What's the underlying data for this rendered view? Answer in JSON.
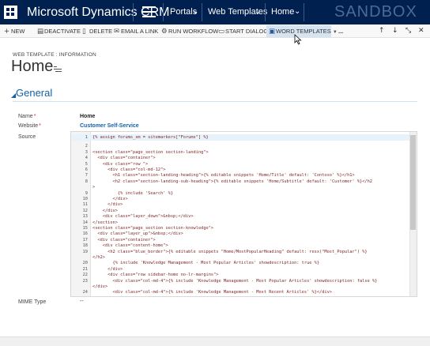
{
  "nav": {
    "app_title": "Microsoft Dynamics CRM",
    "items": [
      {
        "label": "Portals"
      },
      {
        "label": "Web Templates"
      },
      {
        "label": "Home"
      }
    ],
    "environment_watermark": "SANDBOX",
    "colors": {
      "bar": "#002050",
      "watermark": "#4d6a96"
    }
  },
  "commands": [
    {
      "label": "NEW",
      "icon": "plus-icon"
    },
    {
      "label": "DEACTIVATE",
      "icon": "deactivate-icon"
    },
    {
      "label": "DELETE",
      "icon": "trash-icon"
    },
    {
      "label": "EMAIL A LINK",
      "icon": "email-icon"
    },
    {
      "label": "RUN WORKFLOW",
      "icon": "workflow-icon"
    },
    {
      "label": "START DIALOG",
      "icon": "dialog-icon"
    },
    {
      "label": "WORD TEMPLATES",
      "icon": "word-icon",
      "has_dropdown": true,
      "active": true
    },
    {
      "label": "...",
      "icon": "more-icon"
    }
  ],
  "record": {
    "entity_label": "WEB TEMPLATE : INFORMATION",
    "title": "Home"
  },
  "section": {
    "title": "General",
    "accent": "#1560a8"
  },
  "fields": {
    "name_label": "Name",
    "name_value": "Home",
    "website_label": "Website",
    "website_value": "Customer Self-Service",
    "source_label": "Source",
    "mime_label": "MIME Type",
    "mime_value": "--"
  },
  "code_lines": [
    {
      "num": "1",
      "text": "{% assign forums_sm = sitemarkers[\"Forums\"] %}"
    },
    {
      "num": "2",
      "text": ""
    },
    {
      "num": "3",
      "text": "<section class=\"page_section section-landing\">"
    },
    {
      "num": "4",
      "text": "  <div class=\"container\">"
    },
    {
      "num": "5",
      "text": "    <div class=\"row \">"
    },
    {
      "num": "6",
      "text": "      <div class=\"col-md-12\">"
    },
    {
      "num": "7",
      "text": "        <h1 class=\"section-landing-heading\">{% editable snippets 'Home/Title' default: 'Contoso' %}</h1>"
    },
    {
      "num": "8",
      "text": "        <h2 class=\"section-landing-sub-heading\">{% editable snippets 'Home/Subtitle' default: 'Customer' %}</h2"
    },
    {
      "num": "",
      "text": ">"
    },
    {
      "num": "9",
      "text": "          {% include 'Search' %}"
    },
    {
      "num": "10",
      "text": "        </div>"
    },
    {
      "num": "11",
      "text": "      </div>"
    },
    {
      "num": "12",
      "text": "    </div>"
    },
    {
      "num": "13",
      "text": "    <div class=\"layer_down\">&nbsp;</div>"
    },
    {
      "num": "14",
      "text": "</section>"
    },
    {
      "num": "15",
      "text": "<section class=\"page_section section-knowledge\">"
    },
    {
      "num": "16",
      "text": "  <div class=\"layer_up\">&nbsp;</div>"
    },
    {
      "num": "17",
      "text": "  <div class=\"container\">"
    },
    {
      "num": "18",
      "text": "    <div class=\"content-home\">"
    },
    {
      "num": "19",
      "text": "      <h2 class=\"blue_border\">{% editable snippets \"Home/MostPopularHeading\" default: resx(\"Most_Popular\") %}"
    },
    {
      "num": "",
      "text": "</h2>"
    },
    {
      "num": "20",
      "text": "        {% include 'Knowledge Management - Most Popular Articles' showdescription: true %}"
    },
    {
      "num": "21",
      "text": "      </div>"
    },
    {
      "num": "22",
      "text": "      <div class=\"row sidebar-home no-lr-margins\">"
    },
    {
      "num": "23",
      "text": "        <div class=\"col-md-4\">{% include 'Knowledge Management - Most Popular Articles' showdescription: false %}"
    },
    {
      "num": "",
      "text": "</div>"
    },
    {
      "num": "24",
      "text": "        <div class=\"col-md-4\">{% include 'Knowledge Management - Most Recent Articles' %}</div>"
    }
  ]
}
